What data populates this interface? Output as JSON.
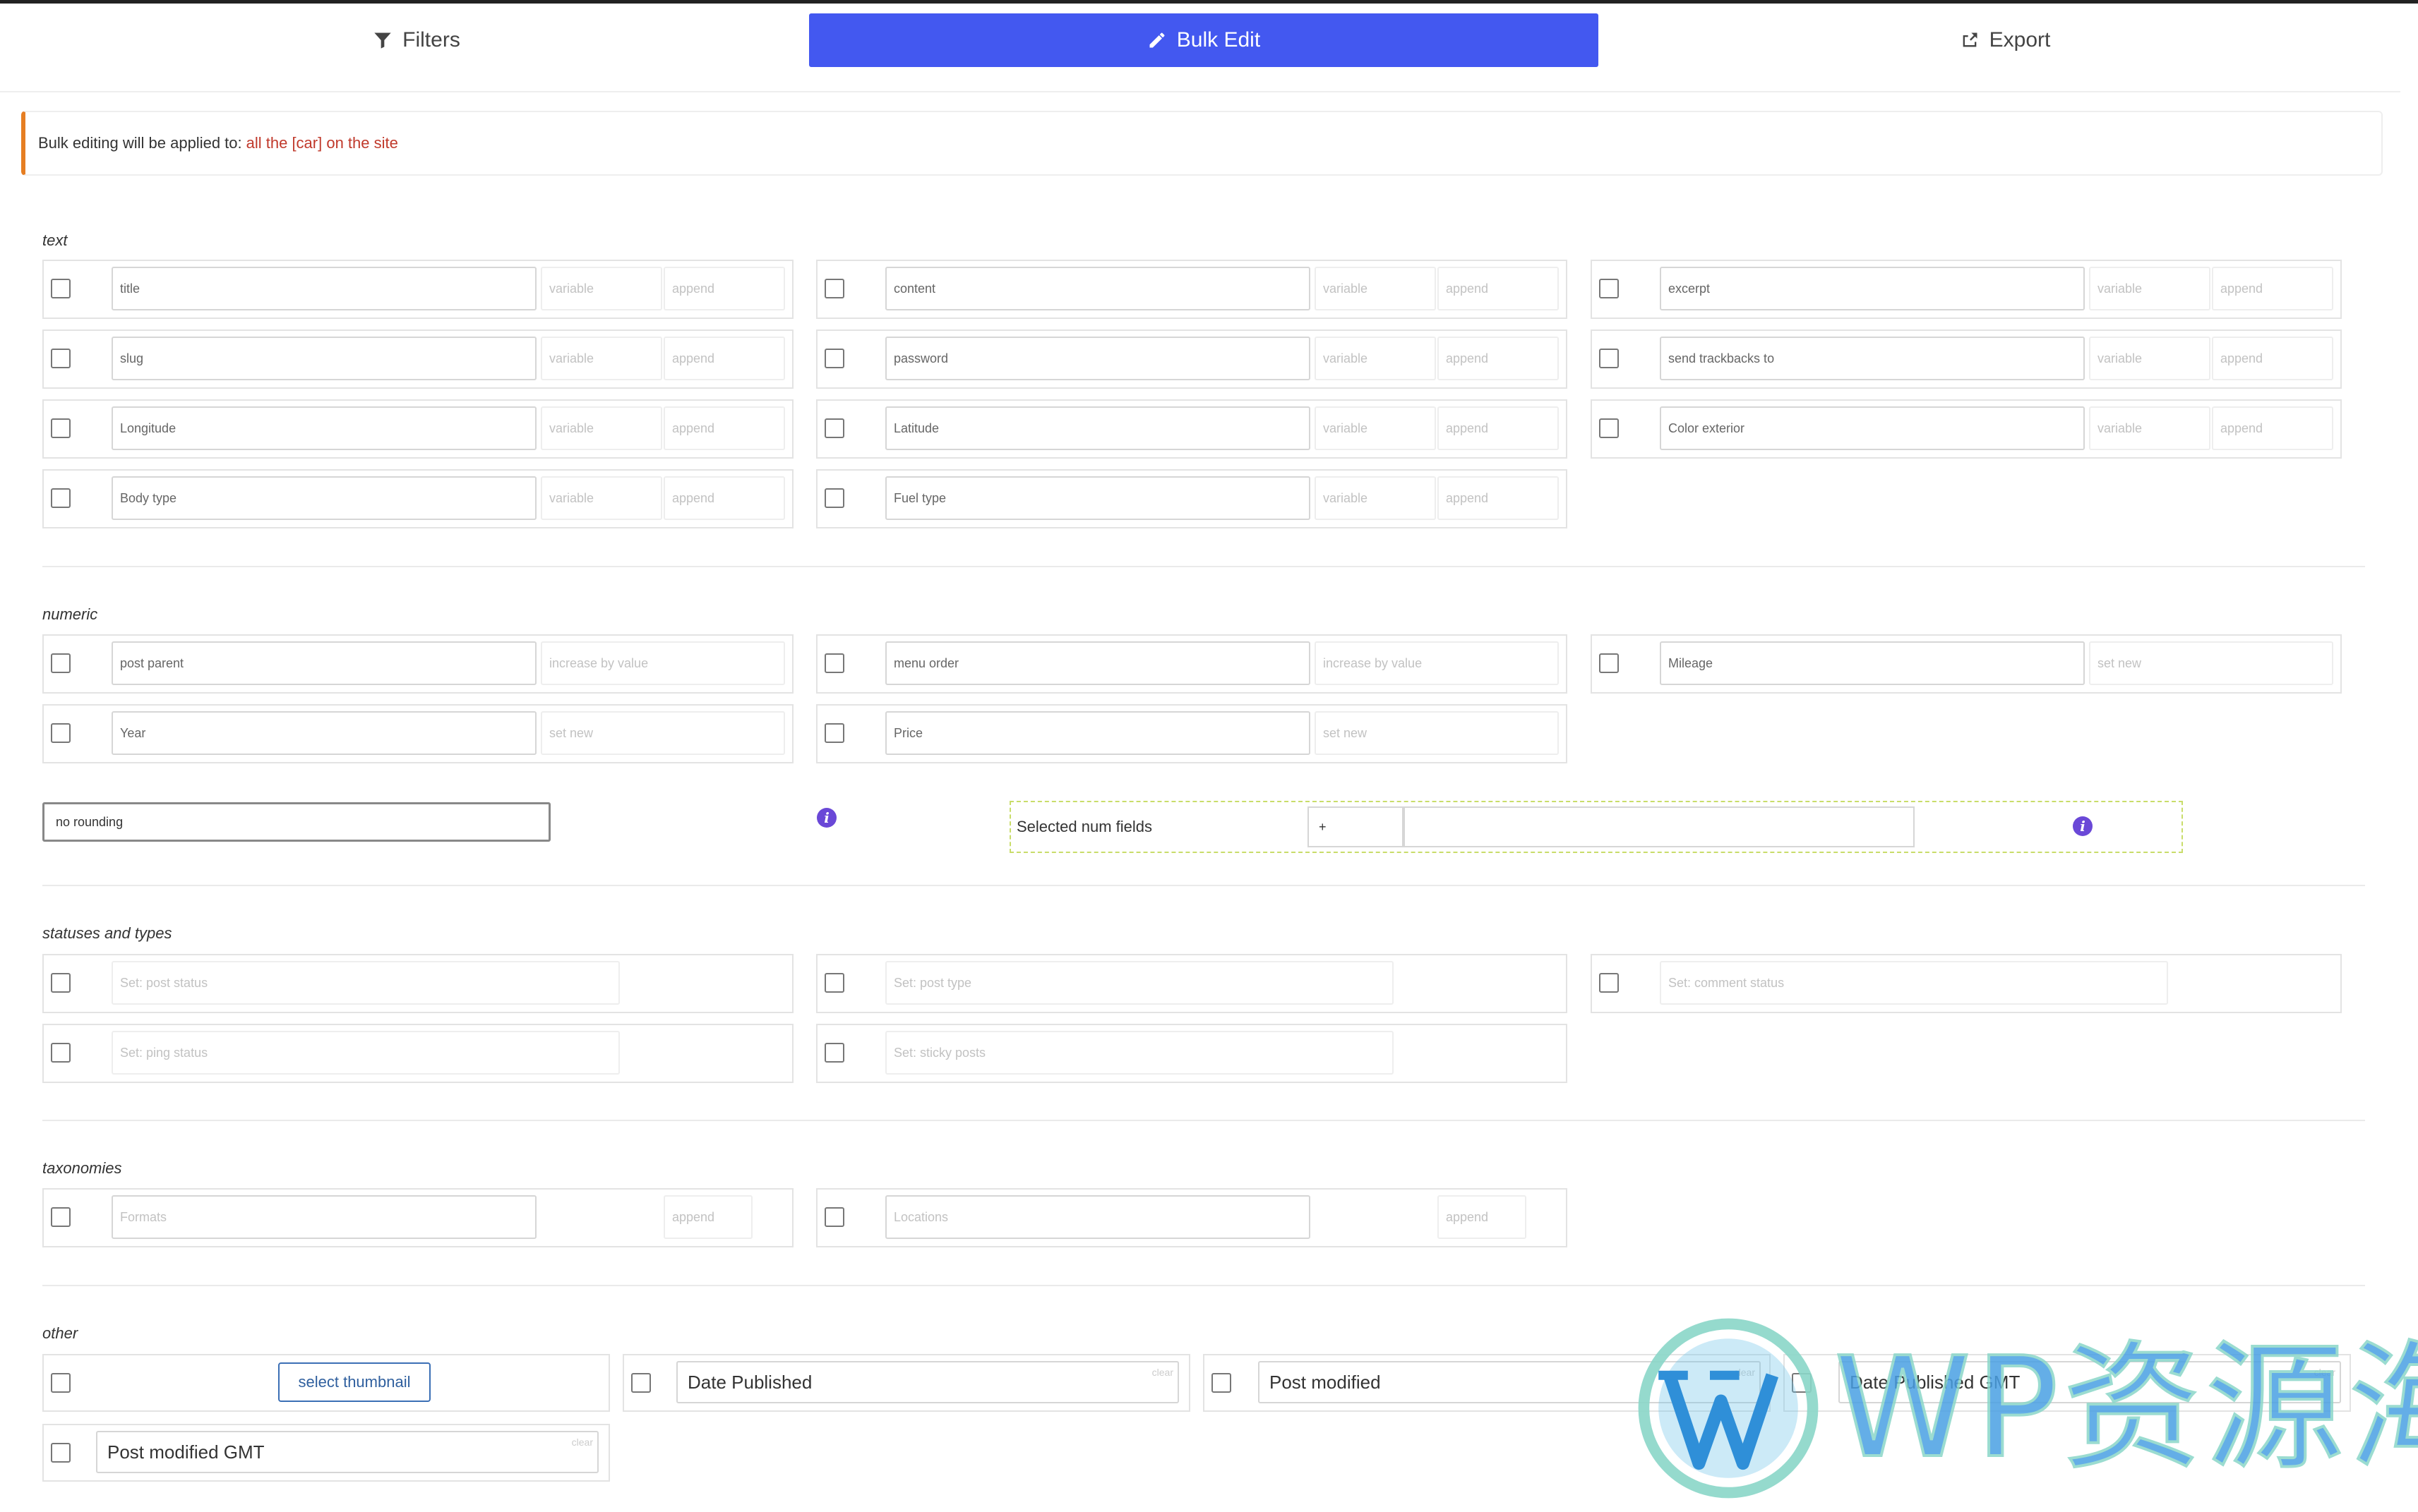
{
  "tabs": [
    {
      "label": "Filters",
      "icon": "filter-icon"
    },
    {
      "label": "Bulk Edit",
      "icon": "pencil-icon"
    },
    {
      "label": "Export",
      "icon": "export-icon"
    }
  ],
  "notice": {
    "prefix": "Bulk editing will be applied to:",
    "highlight": "all the [car] on the site",
    "accent": "#e67e22"
  },
  "sections": {
    "text": "text",
    "numeric": "numeric",
    "statuses": "statuses and types",
    "taxonomies": "taxonomies",
    "other": "other"
  },
  "text_fields": [
    {
      "label": "title",
      "mode": "variable",
      "action": "append"
    },
    {
      "label": "content",
      "mode": "variable",
      "action": "append"
    },
    {
      "label": "excerpt",
      "mode": "variable",
      "action": "append"
    },
    {
      "label": "slug",
      "mode": "variable",
      "action": "append"
    },
    {
      "label": "password",
      "mode": "variable",
      "action": "append"
    },
    {
      "label": "send trackbacks to",
      "mode": "variable",
      "action": "append"
    },
    {
      "label": "Longitude",
      "mode": "variable",
      "action": "append"
    },
    {
      "label": "Latitude",
      "mode": "variable",
      "action": "append"
    },
    {
      "label": "Color exterior",
      "mode": "variable",
      "action": "append"
    },
    {
      "label": "Body type",
      "mode": "variable",
      "action": "append"
    },
    {
      "label": "Fuel type",
      "mode": "variable",
      "action": "append"
    }
  ],
  "numeric_fields": [
    {
      "label": "post parent",
      "action": "increase by value"
    },
    {
      "label": "menu order",
      "action": "increase by value"
    },
    {
      "label": "Mileage",
      "action": "set new"
    },
    {
      "label": "Year",
      "action": "set new"
    },
    {
      "label": "Price",
      "action": "set new"
    }
  ],
  "rounding": "no rounding",
  "num_fields": {
    "label": "Selected num fields",
    "operator": "+"
  },
  "status_fields": [
    {
      "placeholder": "Set: post status"
    },
    {
      "placeholder": "Set: post type"
    },
    {
      "placeholder": "Set: comment status"
    },
    {
      "placeholder": "Set: ping status"
    },
    {
      "placeholder": "Set: sticky posts"
    }
  ],
  "taxonomy_fields": [
    {
      "placeholder": "Formats",
      "action": "append"
    },
    {
      "placeholder": "Locations",
      "action": "append"
    }
  ],
  "other": {
    "thumbnail_button": "select thumbnail",
    "dates": [
      "Date Published",
      "Post modified",
      "Date Published GMT",
      "Post modified GMT"
    ],
    "clear": "clear"
  },
  "watermark": "WP资源海",
  "colors": {
    "primary": "#4358f0",
    "highlight": "#c0392b",
    "info": "#6a48d7"
  }
}
